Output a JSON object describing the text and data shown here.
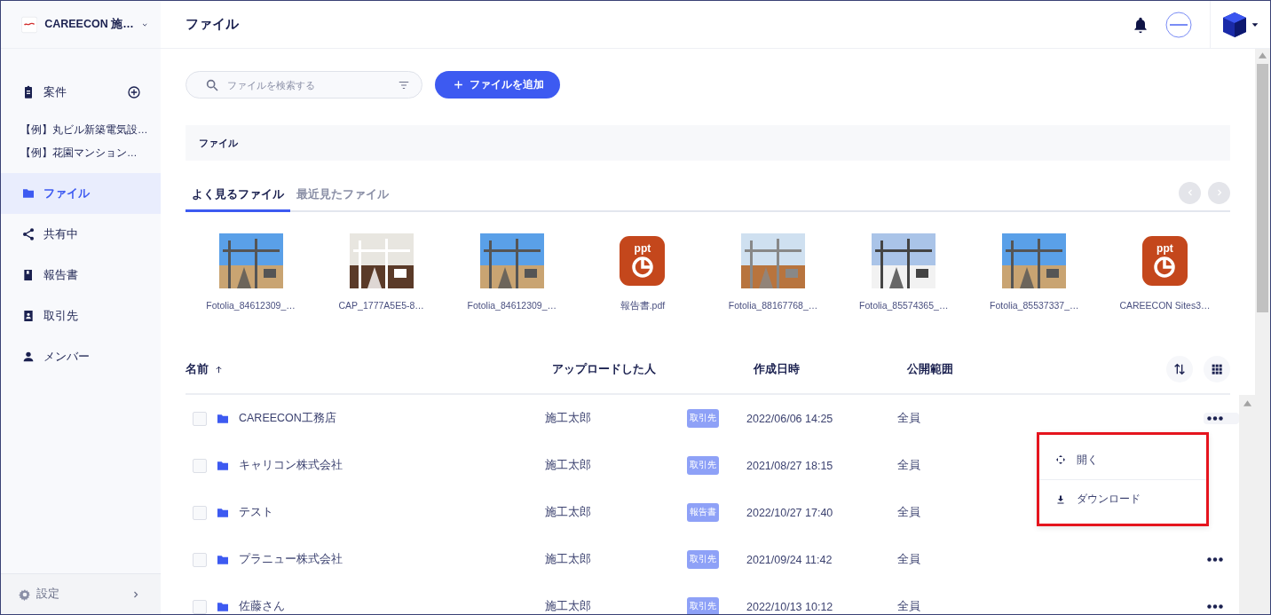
{
  "company": {
    "name": "CAREECON 施…"
  },
  "page_title": "ファイル",
  "sidebar": {
    "items": [
      {
        "kind": "header",
        "label": "案件"
      },
      {
        "kind": "sub",
        "label": "【例】丸ビル新築電気設…"
      },
      {
        "kind": "sub",
        "label": "【例】花園マンション…"
      },
      {
        "kind": "nav",
        "label": "ファイル",
        "selected": true
      },
      {
        "kind": "nav",
        "label": "共有中",
        "selected": false
      },
      {
        "kind": "nav",
        "label": "報告書",
        "selected": false
      },
      {
        "kind": "nav",
        "label": "取引先",
        "selected": false
      },
      {
        "kind": "nav",
        "label": "メンバー",
        "selected": false
      }
    ],
    "footer": {
      "label": "設定"
    }
  },
  "search": {
    "placeholder": "ファイルを検索する"
  },
  "add_button": {
    "label": "ファイルを追加"
  },
  "breadcrumb": "ファイル",
  "tabs": [
    {
      "label": "よく見るファイル",
      "selected": true
    },
    {
      "label": "最近見たファイル",
      "selected": false
    }
  ],
  "files": [
    {
      "name": "Fotolia_84612309_…"
    },
    {
      "name": "CAP_1777A5E5-8…"
    },
    {
      "name": "Fotolia_84612309_…"
    },
    {
      "kind": "ppt",
      "badge": "ppt",
      "name": "報告書.pdf"
    },
    {
      "name": "Fotolia_88167768_…"
    },
    {
      "name": "Fotolia_85574365_…"
    },
    {
      "name": "Fotolia_85537337_…"
    },
    {
      "kind": "ppt",
      "badge": "ppt",
      "name": "CAREECON Sites3…"
    }
  ],
  "table": {
    "columns": [
      "名前",
      "アップロードした人",
      "作成日時",
      "公開範囲"
    ],
    "rows": [
      {
        "checked": false,
        "menu_open": true,
        "name": "CAREECON工務店",
        "uploader": "施工太郎",
        "tag": "取引先",
        "date": "2022/06/06 14:25",
        "scope": "全員"
      },
      {
        "checked": false,
        "name": "キャリコン株式会社",
        "uploader": "施工太郎",
        "tag": "取引先",
        "date": "2021/08/27 18:15",
        "scope": "全員"
      },
      {
        "checked": false,
        "name": "テスト",
        "uploader": "施工太郎",
        "tag": "報告書",
        "date": "2022/10/27 17:40",
        "scope": "全員"
      },
      {
        "checked": false,
        "name": "プラニュー株式会社",
        "uploader": "施工太郎",
        "tag": "取引先",
        "date": "2021/09/24 11:42",
        "scope": "全員"
      },
      {
        "checked": false,
        "name": "佐藤さん",
        "uploader": "施工太郎",
        "tag": "取引先",
        "date": "2022/10/13 10:12",
        "scope": "全員"
      }
    ]
  },
  "context_menu": {
    "items": [
      {
        "kind": "open",
        "label": "開く"
      },
      {
        "kind": "download",
        "label": "ダウンロード"
      }
    ]
  }
}
